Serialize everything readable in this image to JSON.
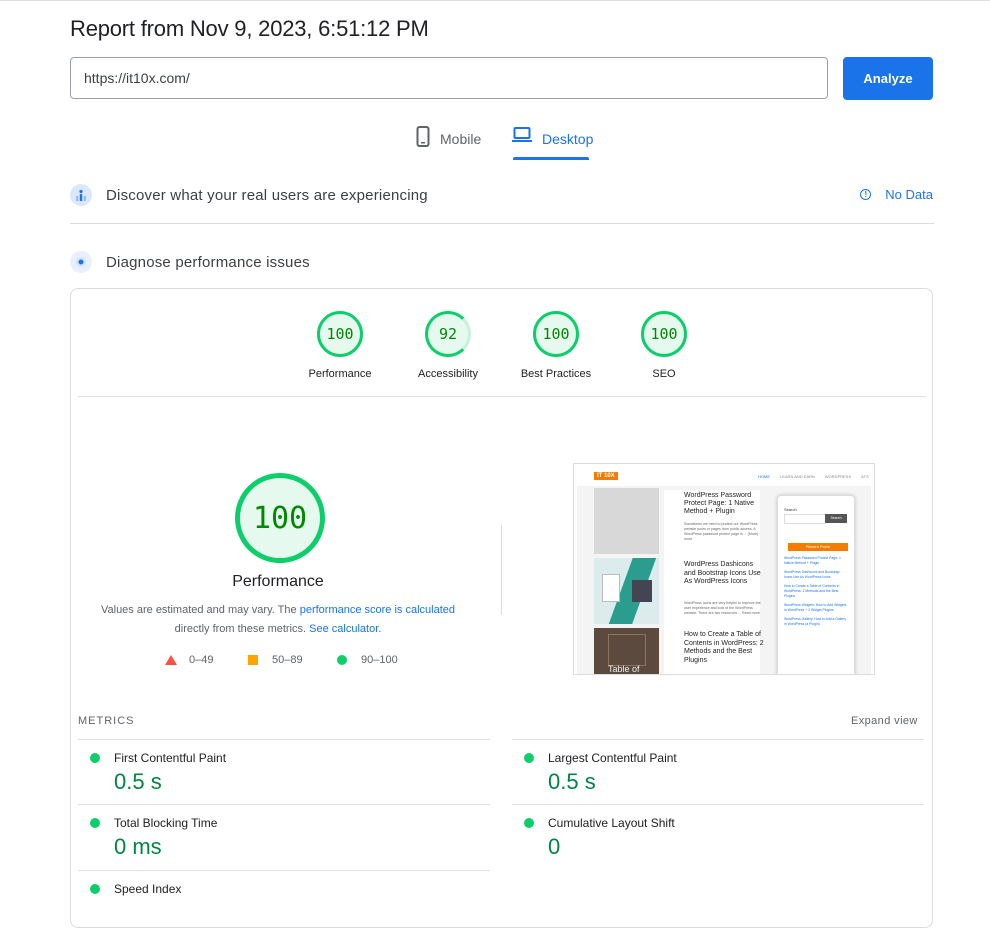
{
  "report": {
    "title": "Report from Nov 9, 2023, 6:51:12 PM"
  },
  "search": {
    "url": "https://it10x.com/",
    "analyze_label": "Analyze"
  },
  "tabs": [
    {
      "label": "Mobile",
      "icon": "phone-icon",
      "active": false
    },
    {
      "label": "Desktop",
      "icon": "laptop-icon",
      "active": true
    }
  ],
  "real_users": {
    "title": "Discover what your real users are experiencing",
    "status": "No Data"
  },
  "diagnose": {
    "title": "Diagnose performance issues"
  },
  "scores": [
    {
      "value": "100",
      "label": "Performance"
    },
    {
      "value": "92",
      "label": "Accessibility"
    },
    {
      "value": "100",
      "label": "Best Practices"
    },
    {
      "value": "100",
      "label": "SEO"
    }
  ],
  "performance": {
    "score": "100",
    "title": "Performance",
    "desc_prefix": "Values are estimated and may vary. The ",
    "desc_link1": "performance score is calculated",
    "desc_middle": " directly from these metrics. ",
    "desc_link2": "See calculator.",
    "legend": [
      "0–49",
      "50–89",
      "90–100"
    ]
  },
  "colors": {
    "accent": "#1a73e8",
    "pass": "#0cce6b",
    "average": "#ffa400",
    "fail": "#ff4e42",
    "pass_text": "#018642"
  },
  "screenshot": {
    "logo": "IT 10X",
    "nav": [
      "HOME",
      "LEARN AND EARN",
      "WORDPRESS",
      "ATS"
    ],
    "posts": [
      {
        "title": "WordPress Password Protect Page: 1 Native Method + Plugin",
        "excerpt": "Sometimes we need to protect our WordPress website posts or pages from public access. A WordPress password protect page is ... (More) more"
      },
      {
        "title": "WordPress Dashicons and Bootstrap Icons Use As WordPress Icons",
        "excerpt": "WordPress Icons are very helpful to improve the user experience and look of the WordPress website. There are two resources ... Read more"
      },
      {
        "title": "How to Create a Table of Contents in WordPress: 2 Methods and the Best Plugins",
        "excerpt": ""
      }
    ],
    "thumb_text": "Table of",
    "sidebar": {
      "search_label": "Search",
      "search_button": "Search",
      "recent_title": "Recent Posts",
      "recent": [
        "WordPress Password Protect Page: 1 Native Method + Plugin",
        "WordPress Dashicons and Bootstrap Icons Use As WordPress Icons",
        "How to Create a Table of Contents in WordPress: 2 Methods and the Best Plugins",
        "WordPress Widgets: How to Add Widgets in WordPress + 2 Widget Plugins",
        "WordPress Gallery: How to Add a Gallery in WordPress (a Plugin)"
      ]
    }
  },
  "metrics": {
    "heading": "METRICS",
    "expand": "Expand view",
    "items": [
      {
        "name": "First Contentful Paint",
        "value": "0.5 s"
      },
      {
        "name": "Largest Contentful Paint",
        "value": "0.5 s"
      },
      {
        "name": "Total Blocking Time",
        "value": "0 ms"
      },
      {
        "name": "Cumulative Layout Shift",
        "value": "0"
      },
      {
        "name": "Speed Index",
        "value": ""
      }
    ]
  }
}
